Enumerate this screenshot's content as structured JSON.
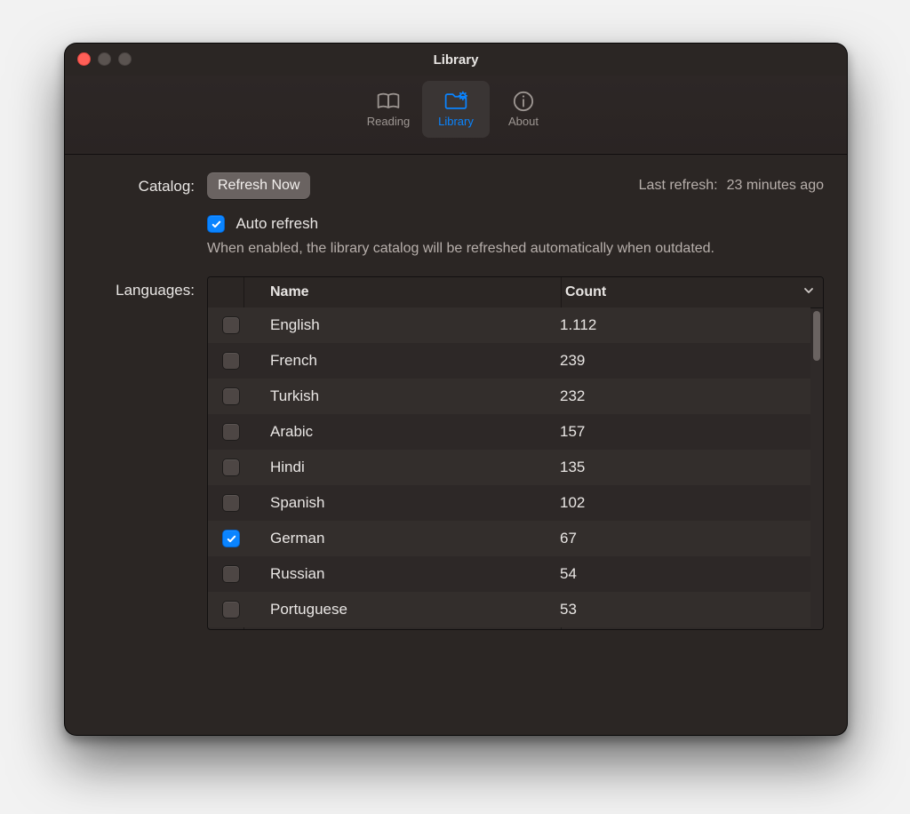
{
  "window": {
    "title": "Library"
  },
  "toolbar": {
    "tabs": [
      {
        "id": "reading",
        "label": "Reading",
        "selected": false
      },
      {
        "id": "library",
        "label": "Library",
        "selected": true
      },
      {
        "id": "about",
        "label": "About",
        "selected": false
      }
    ]
  },
  "catalog": {
    "label": "Catalog:",
    "refresh_button": "Refresh Now",
    "last_refresh_label": "Last refresh:",
    "last_refresh_value": "23 minutes ago",
    "auto_refresh_label": "Auto refresh",
    "auto_refresh_checked": true,
    "auto_refresh_hint": "When enabled, the library catalog will be refreshed automatically when outdated."
  },
  "languages": {
    "label": "Languages:",
    "columns": {
      "name": "Name",
      "count": "Count"
    },
    "rows": [
      {
        "name": "English",
        "count": "1.112",
        "checked": false
      },
      {
        "name": "French",
        "count": "239",
        "checked": false
      },
      {
        "name": "Turkish",
        "count": "232",
        "checked": false
      },
      {
        "name": "Arabic",
        "count": "157",
        "checked": false
      },
      {
        "name": "Hindi",
        "count": "135",
        "checked": false
      },
      {
        "name": "Spanish",
        "count": "102",
        "checked": false
      },
      {
        "name": "German",
        "count": "67",
        "checked": true
      },
      {
        "name": "Russian",
        "count": "54",
        "checked": false
      },
      {
        "name": "Portuguese",
        "count": "53",
        "checked": false
      }
    ]
  }
}
